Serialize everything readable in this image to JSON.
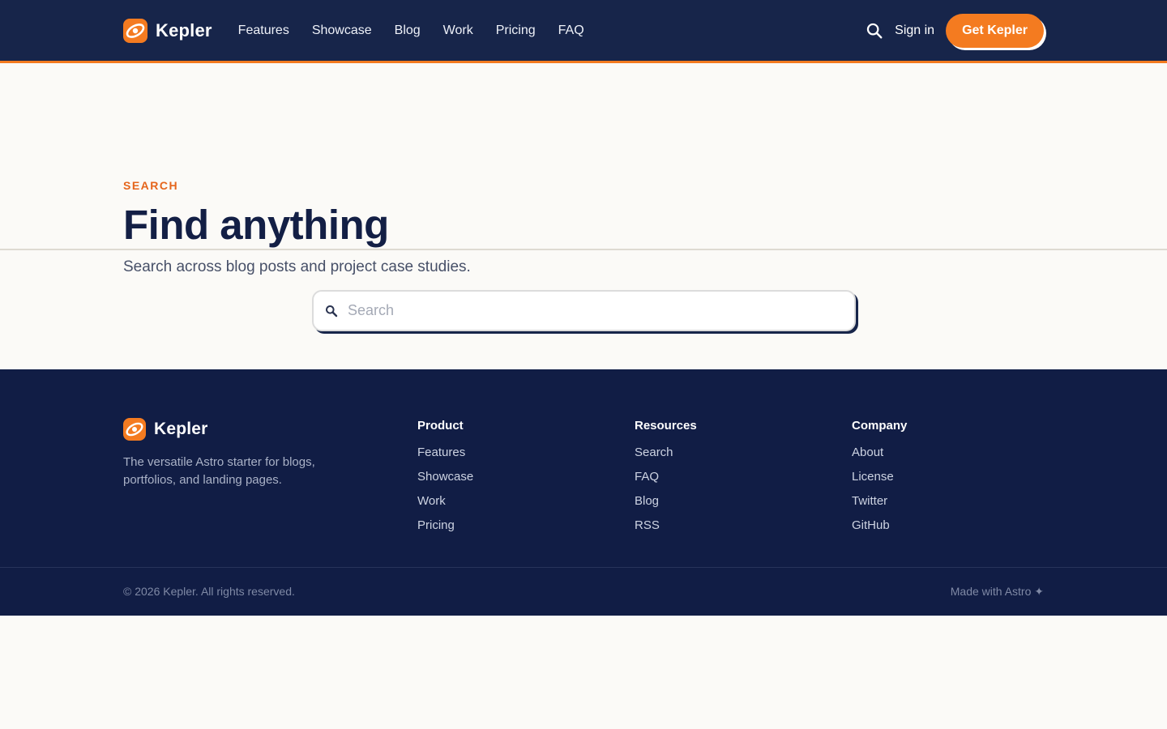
{
  "brand": {
    "name": "Kepler",
    "accent": "#f47b20",
    "navy": "#17254a"
  },
  "header": {
    "nav": [
      "Features",
      "Showcase",
      "Blog",
      "Work",
      "Pricing",
      "FAQ"
    ],
    "search_icon": "search-icon",
    "signin_label": "Sign in",
    "cta_label": "Get Kepler"
  },
  "hero": {
    "eyebrow": "SEARCH",
    "title": "Find anything",
    "subtitle": "Search across blog posts and project case studies."
  },
  "search": {
    "placeholder": "Search",
    "value": ""
  },
  "footer": {
    "tagline": "The versatile Astro starter for blogs, portfolios, and landing pages.",
    "columns": [
      {
        "title": "Product",
        "links": [
          "Features",
          "Showcase",
          "Work",
          "Pricing"
        ]
      },
      {
        "title": "Resources",
        "links": [
          "Search",
          "FAQ",
          "Blog",
          "RSS"
        ]
      },
      {
        "title": "Company",
        "links": [
          "About",
          "License",
          "Twitter",
          "GitHub"
        ]
      }
    ],
    "copyright": "© 2026 Kepler. All rights reserved.",
    "made_with": "Made with Astro ✦"
  }
}
